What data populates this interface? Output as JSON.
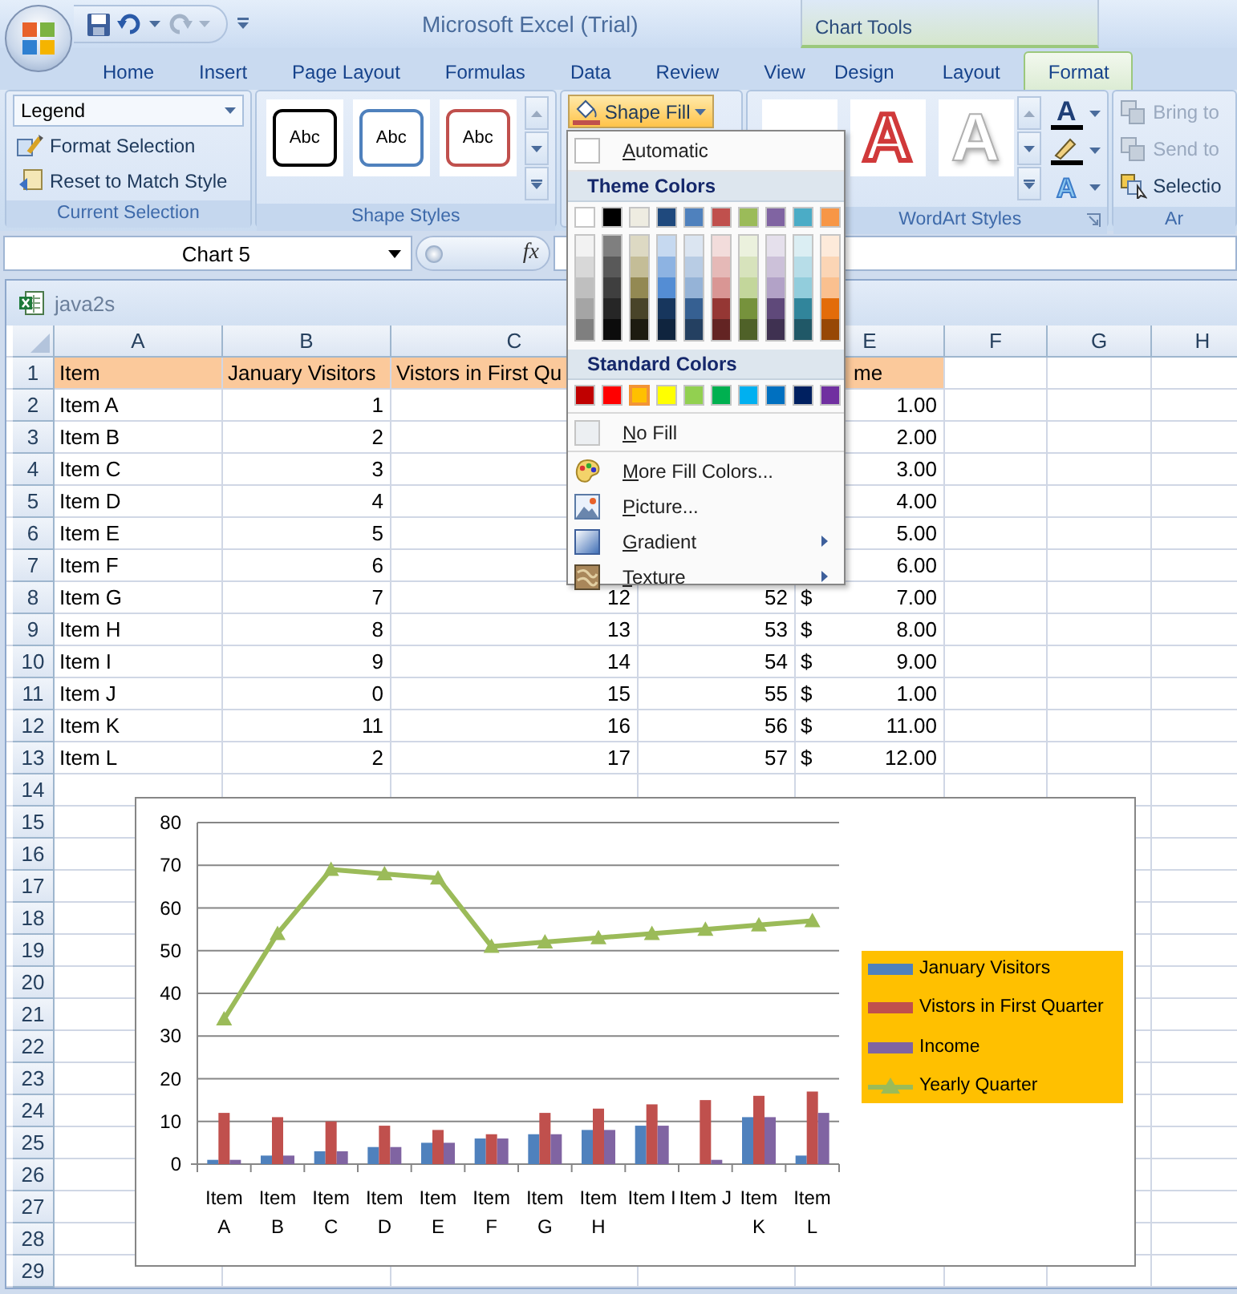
{
  "title_bar": {
    "title": "Microsoft Excel (Trial)",
    "context_label": "Chart Tools"
  },
  "tabs": [
    {
      "label": "Home",
      "selected": false,
      "contextual": false
    },
    {
      "label": "Insert",
      "selected": false,
      "contextual": false
    },
    {
      "label": "Page Layout",
      "selected": false,
      "contextual": false
    },
    {
      "label": "Formulas",
      "selected": false,
      "contextual": false
    },
    {
      "label": "Data",
      "selected": false,
      "contextual": false
    },
    {
      "label": "Review",
      "selected": false,
      "contextual": false
    },
    {
      "label": "View",
      "selected": false,
      "contextual": false
    },
    {
      "label": "Design",
      "selected": false,
      "contextual": true
    },
    {
      "label": "Layout",
      "selected": false,
      "contextual": true
    },
    {
      "label": "Format",
      "selected": true,
      "contextual": true
    }
  ],
  "ribbon": {
    "current_selection": {
      "element": "Legend",
      "buttons": [
        {
          "label": "Format Selection",
          "kind": "format"
        },
        {
          "label": "Reset to Match Style",
          "kind": "reset"
        }
      ],
      "label": "Current Selection"
    },
    "shape_styles": {
      "styles": [
        {
          "text": "Abc",
          "color": "#000000"
        },
        {
          "text": "Abc",
          "color": "#4f81bd"
        },
        {
          "text": "Abc",
          "color": "#c0504d"
        }
      ],
      "label": "Shape Styles"
    },
    "shape_fill": {
      "label": "Shape Fill",
      "open": true
    },
    "wordart_styles": {
      "styles": [
        {
          "glyph": "A",
          "kind": "red-outline"
        },
        {
          "glyph": "A",
          "kind": "white-shadow"
        }
      ],
      "tools": [
        {
          "kind": "fill",
          "glyph": "A"
        },
        {
          "kind": "outline"
        },
        {
          "kind": "effects",
          "glyph": "A"
        }
      ],
      "label": "WordArt Styles"
    },
    "arrange": {
      "buttons": [
        {
          "label": "Bring to",
          "kind": "bring",
          "disabled": true
        },
        {
          "label": "Send to",
          "kind": "send",
          "disabled": true
        },
        {
          "label": "Selectio",
          "kind": "selection",
          "disabled": false
        }
      ],
      "label": "Ar"
    }
  },
  "formula_bar": {
    "name_box": "Chart 5",
    "function_symbol": "fx"
  },
  "workbook": {
    "title": "java2s",
    "columns": [
      "A",
      "B",
      "C",
      null,
      "E",
      "F",
      "G",
      "H"
    ],
    "rows": [
      {
        "num": "1",
        "header": true,
        "a": "Item",
        "b": "January Visitors",
        "c": "Vistors in First Qu",
        "e": "me"
      },
      {
        "num": "2",
        "header": false,
        "a": "Item A",
        "b": "1",
        "e": "1.00"
      },
      {
        "num": "3",
        "header": false,
        "a": "Item B",
        "b": "2",
        "e": "2.00"
      },
      {
        "num": "4",
        "header": false,
        "a": "Item C",
        "b": "3",
        "e": "3.00"
      },
      {
        "num": "5",
        "header": false,
        "a": "Item D",
        "b": "4",
        "e": "4.00"
      },
      {
        "num": "6",
        "header": false,
        "a": "Item E",
        "b": "5",
        "e": "5.00"
      },
      {
        "num": "7",
        "header": false,
        "a": "Item F",
        "b": "6",
        "e": "6.00"
      },
      {
        "num": "8",
        "header": false,
        "a": "Item G",
        "b": "7",
        "c": "12",
        "d": "52",
        "e_currency": "$",
        "e": "7.00"
      },
      {
        "num": "9",
        "header": false,
        "a": "Item H",
        "b": "8",
        "c": "13",
        "d": "53",
        "e_currency": "$",
        "e": "8.00"
      },
      {
        "num": "10",
        "header": false,
        "a": "Item I",
        "b": "9",
        "c": "14",
        "d": "54",
        "e_currency": "$",
        "e": "9.00"
      },
      {
        "num": "11",
        "header": false,
        "a": "Item J",
        "b": "0",
        "c": "15",
        "d": "55",
        "e_currency": "$",
        "e": "1.00"
      },
      {
        "num": "12",
        "header": false,
        "a": "Item K",
        "b": "11",
        "c": "16",
        "d": "56",
        "e_currency": "$",
        "e": "11.00"
      },
      {
        "num": "13",
        "header": false,
        "a": "Item L",
        "b": "2",
        "c": "17",
        "d": "57",
        "e_currency": "$",
        "e": "12.00"
      },
      {
        "num": "14",
        "header": false
      },
      {
        "num": "15",
        "header": false
      },
      {
        "num": "16",
        "header": false
      },
      {
        "num": "17",
        "header": false
      },
      {
        "num": "18",
        "header": false
      },
      {
        "num": "19",
        "header": false
      },
      {
        "num": "20",
        "header": false
      },
      {
        "num": "21",
        "header": false
      },
      {
        "num": "22",
        "header": false
      },
      {
        "num": "23",
        "header": false
      },
      {
        "num": "24",
        "header": false
      },
      {
        "num": "25",
        "header": false
      },
      {
        "num": "26",
        "header": false
      },
      {
        "num": "27",
        "header": false
      },
      {
        "num": "28",
        "header": false
      },
      {
        "num": "29",
        "header": false
      }
    ]
  },
  "chart": {
    "chart_data": {
      "type": "bar",
      "categories": [
        "Item A",
        "Item B",
        "Item C",
        "Item D",
        "Item E",
        "Item F",
        "Item G",
        "Item H",
        "Item I",
        "Item J",
        "Item K",
        "Item L"
      ],
      "ylim": [
        0,
        80
      ],
      "yticks": [
        0,
        10,
        20,
        30,
        40,
        50,
        60,
        70,
        80
      ],
      "grid": true,
      "legend": true,
      "series": [
        {
          "name": "January Visitors",
          "color": "#4f81bd",
          "values": [
            1,
            2,
            3,
            4,
            5,
            6,
            7,
            8,
            9,
            0,
            11,
            2
          ]
        },
        {
          "name": "Vistors in First Quarter",
          "color": "#c0504d",
          "values": [
            12,
            11,
            10,
            9,
            8,
            7,
            12,
            13,
            14,
            15,
            16,
            17
          ]
        },
        {
          "name": "Income",
          "color": "#8064a2",
          "values": [
            1,
            2,
            3,
            4,
            5,
            6,
            7,
            8,
            9,
            1,
            11,
            12
          ]
        },
        {
          "name": "Yearly Quarter",
          "type": "line",
          "marker": "triangle",
          "color": "#9bbb59",
          "values": [
            34,
            54,
            69,
            68,
            67,
            51,
            52,
            53,
            54,
            55,
            56,
            57
          ]
        }
      ]
    }
  },
  "fill_menu": {
    "automatic": "Automatic",
    "theme_header": "Theme Colors",
    "theme_colors": [
      {
        "color": "#ffffff",
        "selected": false,
        "shades": [
          {
            "color": "#f2f2f2",
            "selected": false
          },
          {
            "color": "#d8d8d8",
            "selected": false
          },
          {
            "color": "#bfbfbf",
            "selected": false
          },
          {
            "color": "#a5a5a5",
            "selected": false
          },
          {
            "color": "#7f7f7f",
            "selected": false
          }
        ]
      },
      {
        "color": "#000000",
        "selected": false,
        "shades": [
          {
            "color": "#7f7f7f",
            "selected": false
          },
          {
            "color": "#595959",
            "selected": false
          },
          {
            "color": "#3f3f3f",
            "selected": false
          },
          {
            "color": "#262626",
            "selected": false
          },
          {
            "color": "#0c0c0c",
            "selected": false
          }
        ]
      },
      {
        "color": "#eeece1",
        "selected": false,
        "shades": [
          {
            "color": "#ddd9c3",
            "selected": false
          },
          {
            "color": "#c4bd97",
            "selected": false
          },
          {
            "color": "#938953",
            "selected": false
          },
          {
            "color": "#494429",
            "selected": false
          },
          {
            "color": "#1d1b10",
            "selected": false
          }
        ]
      },
      {
        "color": "#1f497d",
        "selected": false,
        "shades": [
          {
            "color": "#c6d9f0",
            "selected": false
          },
          {
            "color": "#8db3e2",
            "selected": false
          },
          {
            "color": "#548dd4",
            "selected": false
          },
          {
            "color": "#17365d",
            "selected": false
          },
          {
            "color": "#0f243e",
            "selected": false
          }
        ]
      },
      {
        "color": "#4f81bd",
        "selected": false,
        "shades": [
          {
            "color": "#dbe5f1",
            "selected": false
          },
          {
            "color": "#b8cce4",
            "selected": false
          },
          {
            "color": "#95b3d7",
            "selected": false
          },
          {
            "color": "#366092",
            "selected": false
          },
          {
            "color": "#244061",
            "selected": false
          }
        ]
      },
      {
        "color": "#c0504d",
        "selected": false,
        "shades": [
          {
            "color": "#f2dcdb",
            "selected": false
          },
          {
            "color": "#e5b9b7",
            "selected": false
          },
          {
            "color": "#d99694",
            "selected": false
          },
          {
            "color": "#953734",
            "selected": false
          },
          {
            "color": "#632423",
            "selected": false
          }
        ]
      },
      {
        "color": "#9bbb59",
        "selected": false,
        "shades": [
          {
            "color": "#ebf1dd",
            "selected": false
          },
          {
            "color": "#d7e3bc",
            "selected": false
          },
          {
            "color": "#c3d69b",
            "selected": false
          },
          {
            "color": "#76923c",
            "selected": false
          },
          {
            "color": "#4f6128",
            "selected": false
          }
        ]
      },
      {
        "color": "#8064a2",
        "selected": false,
        "shades": [
          {
            "color": "#e5e0ec",
            "selected": false
          },
          {
            "color": "#ccc1d9",
            "selected": false
          },
          {
            "color": "#b2a2c7",
            "selected": false
          },
          {
            "color": "#5f497a",
            "selected": false
          },
          {
            "color": "#3f3151",
            "selected": false
          }
        ]
      },
      {
        "color": "#4bacc6",
        "selected": false,
        "shades": [
          {
            "color": "#dbeef3",
            "selected": false
          },
          {
            "color": "#b7dde8",
            "selected": false
          },
          {
            "color": "#92cddc",
            "selected": false
          },
          {
            "color": "#31859b",
            "selected": false
          },
          {
            "color": "#205867",
            "selected": false
          }
        ]
      },
      {
        "color": "#f79646",
        "selected": false,
        "shades": [
          {
            "color": "#fdeada",
            "selected": false
          },
          {
            "color": "#fbd5b5",
            "selected": false
          },
          {
            "color": "#fac08f",
            "selected": false
          },
          {
            "color": "#e36c09",
            "selected": false
          },
          {
            "color": "#974806",
            "selected": false
          }
        ]
      }
    ],
    "standard_header": "Standard Colors",
    "standard_colors": [
      {
        "color": "#c00000",
        "selected": false
      },
      {
        "color": "#ff0000",
        "selected": false
      },
      {
        "color": "#ffc000",
        "selected": true
      },
      {
        "color": "#ffff00",
        "selected": false
      },
      {
        "color": "#92d050",
        "selected": false
      },
      {
        "color": "#00b050",
        "selected": false
      },
      {
        "color": "#00b0f0",
        "selected": false
      },
      {
        "color": "#0070c0",
        "selected": false
      },
      {
        "color": "#002060",
        "selected": false
      },
      {
        "color": "#7030a0",
        "selected": false
      }
    ],
    "items": [
      {
        "label": "No Fill",
        "kind": "no-fill",
        "submenu": false
      },
      {
        "label": "More Fill Colors...",
        "kind": "palette",
        "submenu": false
      },
      {
        "label": "Picture...",
        "kind": "picture",
        "submenu": false
      },
      {
        "label": "Gradient",
        "kind": "gradient",
        "submenu": true
      },
      {
        "label": "Texture",
        "kind": "texture",
        "submenu": true
      }
    ]
  }
}
